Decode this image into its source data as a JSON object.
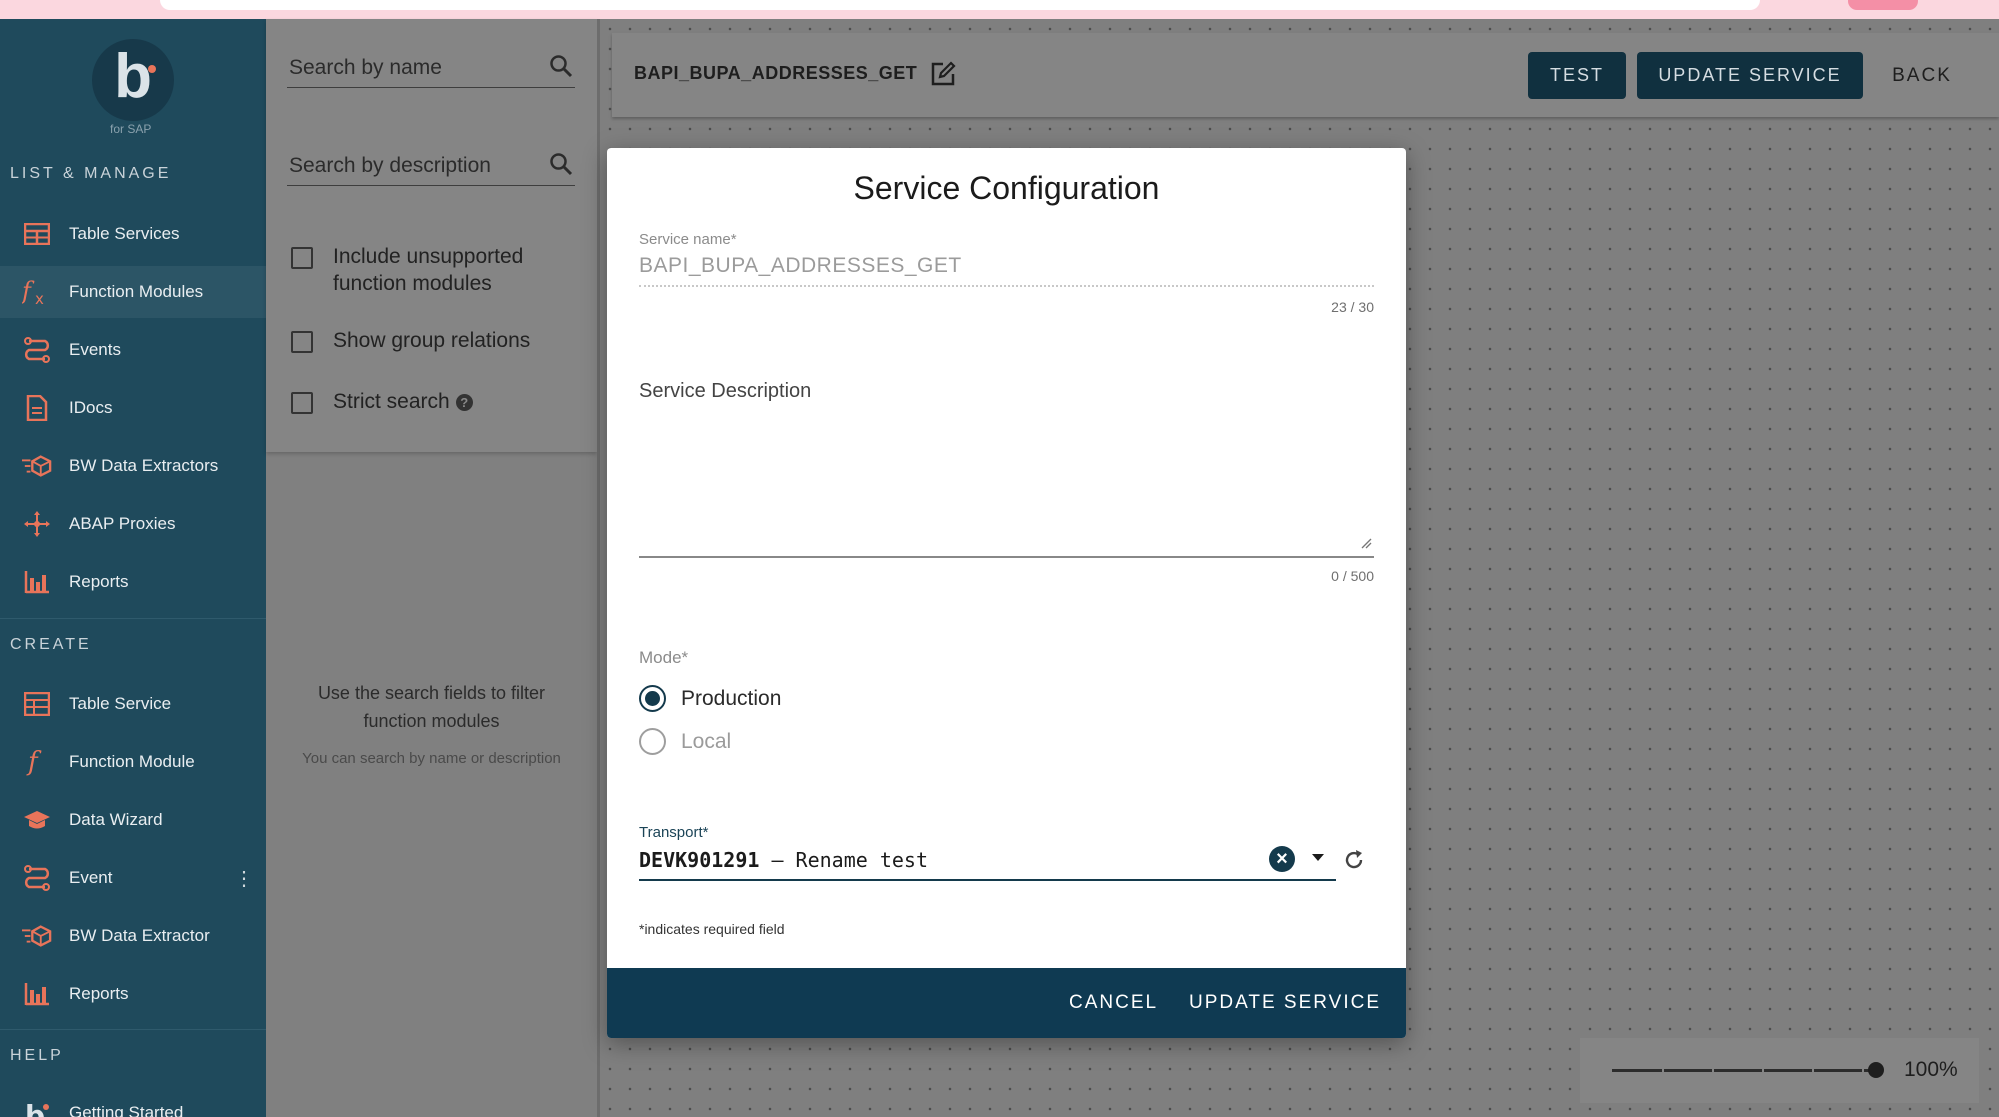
{
  "logo": {
    "sub": "for SAP"
  },
  "sidebar": {
    "sections": {
      "list_manage": "LIST & MANAGE",
      "create": "CREATE",
      "help": "HELP"
    },
    "list_items": [
      {
        "label": "Table Services",
        "icon": "table-icon"
      },
      {
        "label": "Function Modules",
        "icon": "function-icon",
        "active": true
      },
      {
        "label": "Events",
        "icon": "events-icon"
      },
      {
        "label": "IDocs",
        "icon": "document-icon"
      },
      {
        "label": "BW Data Extractors",
        "icon": "extractor-icon"
      },
      {
        "label": "ABAP Proxies",
        "icon": "proxy-icon"
      },
      {
        "label": "Reports",
        "icon": "bar-chart-icon"
      }
    ],
    "create_items": [
      {
        "label": "Table Service",
        "icon": "table-plus-icon"
      },
      {
        "label": "Function Module",
        "icon": "function-icon"
      },
      {
        "label": "Data Wizard",
        "icon": "graduation-cap-icon"
      },
      {
        "label": "Event",
        "icon": "events-icon"
      },
      {
        "label": "BW Data Extractor",
        "icon": "extractor-icon"
      },
      {
        "label": "Reports",
        "icon": "bar-chart-icon"
      }
    ],
    "help_items": [
      {
        "label": "Getting Started",
        "icon": "logo-b-icon"
      }
    ]
  },
  "filter": {
    "search_name_placeholder": "Search by name",
    "search_desc_placeholder": "Search by description",
    "include_unsupported_line1": "Include unsupported",
    "include_unsupported_line2": "function modules",
    "show_group_relations": "Show group relations",
    "strict_search": "Strict search",
    "empty_line1": "Use the search fields to filter",
    "empty_line2": "function modules",
    "empty_sub": "You can search by name or description"
  },
  "topbar": {
    "service_name": "BAPI_BUPA_ADDRESSES_GET",
    "test_label": "TEST",
    "update_label": "UPDATE SERVICE",
    "back_label": "BACK"
  },
  "zoom": {
    "value": "100%",
    "level": 1.0
  },
  "modal": {
    "title": "Service Configuration",
    "service_name_label": "Service name*",
    "service_name_value": "BAPI_BUPA_ADDRESSES_GET",
    "service_name_counter": "23 / 30",
    "description_label": "Service Description",
    "description_counter": "0 / 500",
    "mode_label": "Mode*",
    "mode_production": "Production",
    "mode_local": "Local",
    "mode_selected": "Production",
    "transport_label": "Transport*",
    "transport_id": "DEVK901291",
    "transport_desc": " – Rename test",
    "required_note": "*indicates required field",
    "cancel_label": "CANCEL",
    "update_label": "UPDATE SERVICE"
  },
  "colors": {
    "sidebar_bg": "#1f4a5c",
    "accent_icon": "#e8745a",
    "primary_dark": "#0f3a52"
  }
}
